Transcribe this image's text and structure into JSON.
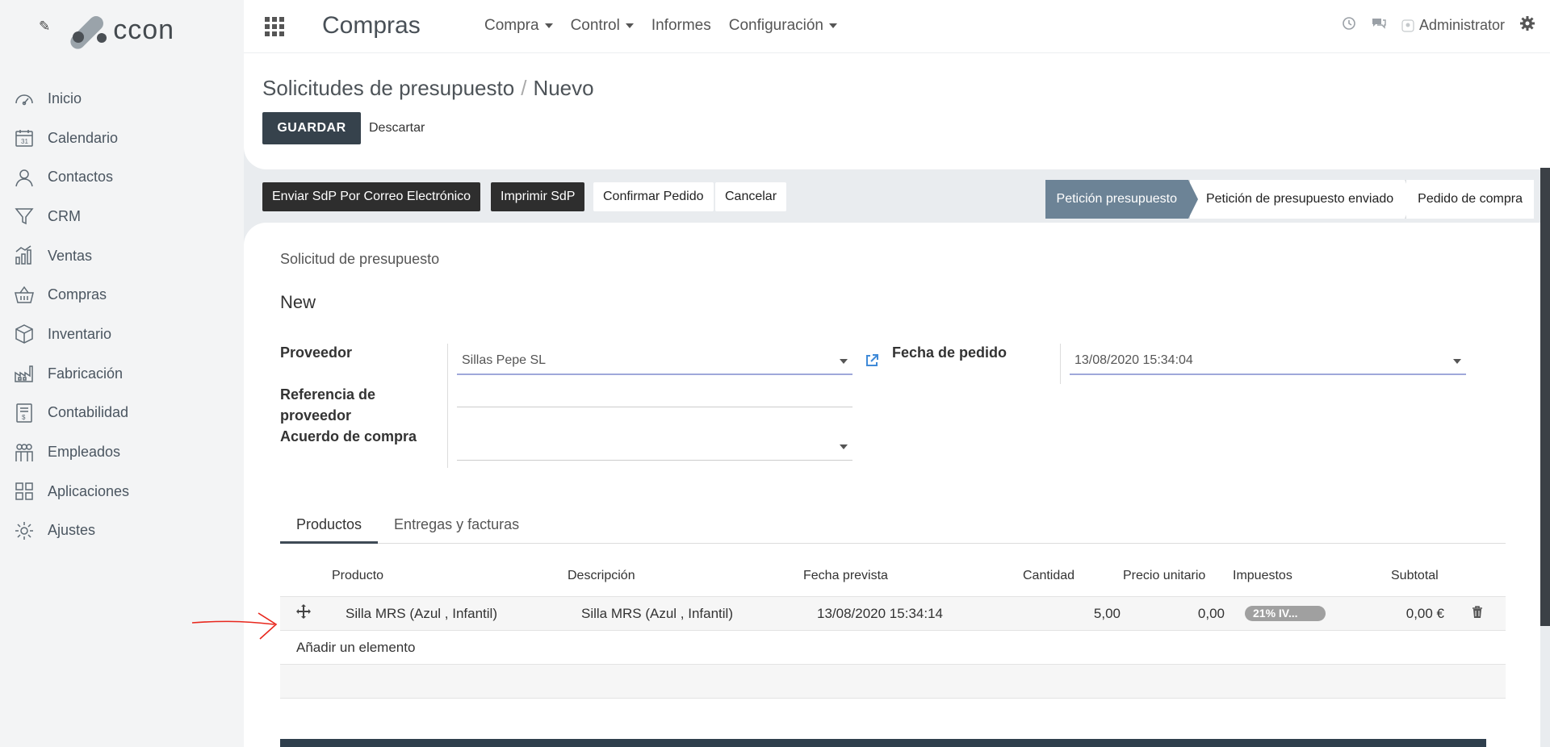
{
  "sidebar": {
    "brand": "ccon",
    "items": [
      {
        "label": "Inicio",
        "icon": "dashboard-icon"
      },
      {
        "label": "Calendario",
        "icon": "calendar-icon"
      },
      {
        "label": "Contactos",
        "icon": "user-icon"
      },
      {
        "label": "CRM",
        "icon": "filter-icon"
      },
      {
        "label": "Ventas",
        "icon": "chart-icon"
      },
      {
        "label": "Compras",
        "icon": "basket-icon"
      },
      {
        "label": "Inventario",
        "icon": "box-icon"
      },
      {
        "label": "Fabricación",
        "icon": "factory-icon"
      },
      {
        "label": "Contabilidad",
        "icon": "invoice-icon"
      },
      {
        "label": "Empleados",
        "icon": "people-icon"
      },
      {
        "label": "Aplicaciones",
        "icon": "apps-icon"
      },
      {
        "label": "Ajustes",
        "icon": "gear-icon"
      }
    ]
  },
  "topbar": {
    "app_title": "Compras",
    "menu": [
      {
        "label": "Compra",
        "dropdown": true
      },
      {
        "label": "Control",
        "dropdown": true
      },
      {
        "label": "Informes",
        "dropdown": false
      },
      {
        "label": "Configuración",
        "dropdown": true
      }
    ],
    "user": "Administrator"
  },
  "control_panel": {
    "breadcrumb_parent": "Solicitudes de presupuesto",
    "breadcrumb_sep": "/",
    "breadcrumb_current": "Nuevo",
    "save_label": "GUARDAR",
    "discard_label": "Descartar"
  },
  "statusbar": {
    "buttons": [
      "Enviar SdP Por Correo Electrónico",
      "Imprimir SdP",
      "Confirmar Pedido",
      "Cancelar"
    ],
    "stages": [
      "Petición presupuesto",
      "Petición de presupuesto enviado",
      "Pedido de compra"
    ],
    "active_stage": "Petición presupuesto"
  },
  "form": {
    "subtitle": "Solicitud de presupuesto",
    "name": "New",
    "labels": {
      "proveedor": "Proveedor",
      "referencia_1": "Referencia de",
      "referencia_2": "proveedor",
      "acuerdo": "Acuerdo de compra",
      "fecha": "Fecha de pedido"
    },
    "values": {
      "proveedor": "Sillas Pepe SL",
      "referencia": "",
      "acuerdo": "",
      "fecha": "13/08/2020 15:34:04"
    }
  },
  "tabs": [
    "Productos",
    "Entregas y facturas"
  ],
  "table": {
    "headers": [
      "Producto",
      "Descripción",
      "Fecha prevista",
      "Cantidad",
      "Precio unitario",
      "Impuestos",
      "Subtotal"
    ],
    "rows": [
      {
        "producto": "Silla MRS (Azul , Infantil)",
        "descripcion": "Silla MRS (Azul , Infantil)",
        "fecha": "13/08/2020 15:34:14",
        "cantidad": "5,00",
        "precio": "0,00",
        "impuestos": "21% IV...",
        "subtotal": "0,00 €"
      }
    ],
    "add_label": "Añadir un elemento"
  },
  "colors": {
    "primary": "#36424c",
    "stage_active": "#6c8396",
    "annotation": "#e8271d"
  }
}
